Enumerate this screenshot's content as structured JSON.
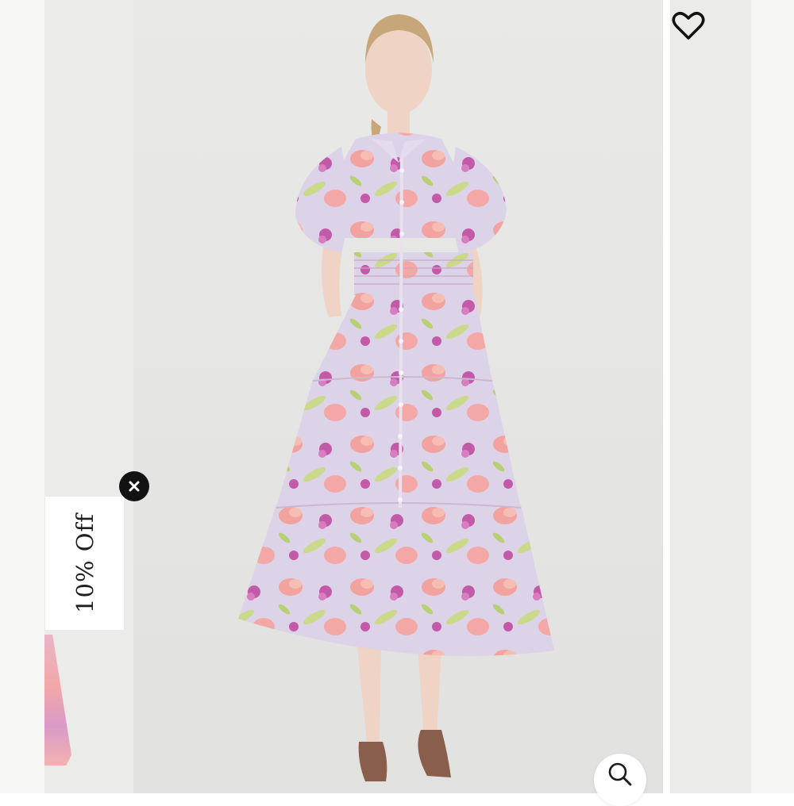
{
  "promo": {
    "label": "10% Off"
  },
  "product": {
    "colors": {
      "background": "#e9e9e7",
      "dress_base": "#ddd3e8",
      "dress_pink": "#f2a39f",
      "dress_magenta": "#c25aa8",
      "dress_green": "#cbd98a",
      "sandals": "#8a5e4c"
    }
  },
  "icons": {
    "close": "close-icon",
    "favorite": "heart-icon",
    "zoom": "search-icon"
  }
}
